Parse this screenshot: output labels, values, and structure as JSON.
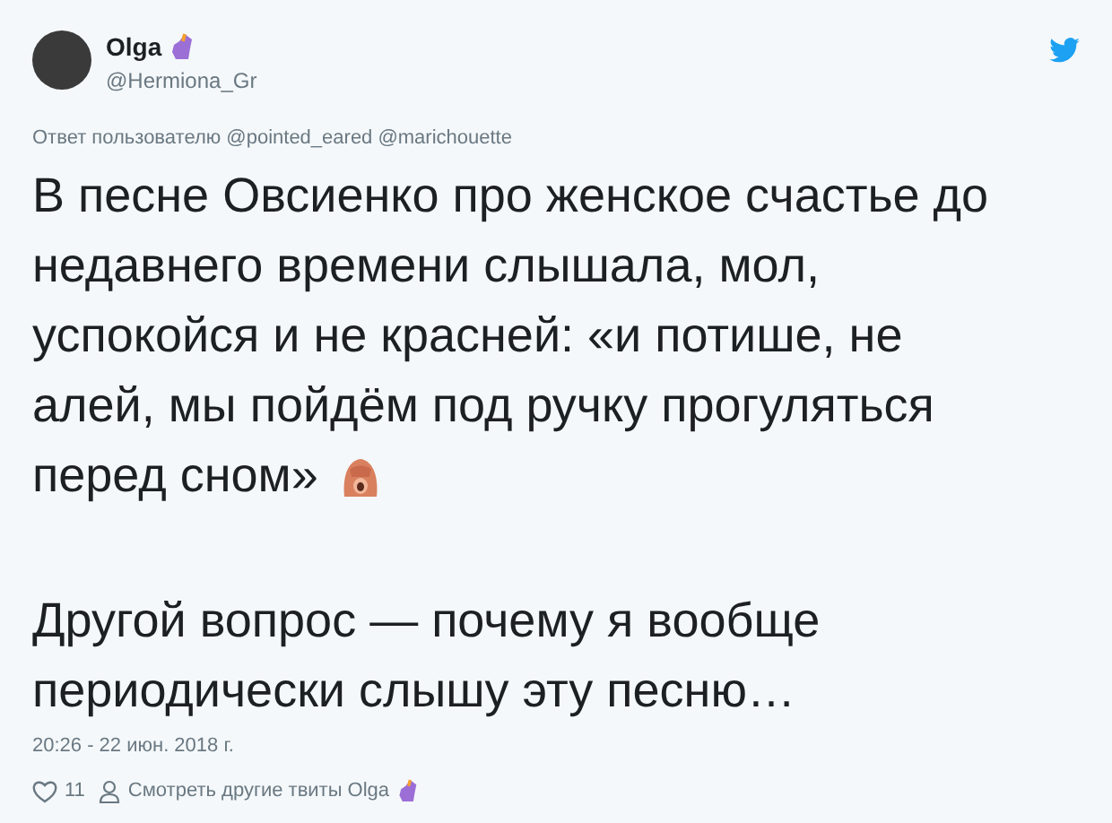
{
  "author": {
    "name": "Olga",
    "handle": "@Hermiona_Gr"
  },
  "reply_to": {
    "prefix": "Ответ пользователю",
    "mentions": [
      "@pointed_eared",
      "@marichouette"
    ]
  },
  "paragraphs": [
    {
      "lines": [
        "В песне Овсиенко про женское счастье до",
        "недавнего времени слышала, мол,",
        "успокойся и не красней: «и потише, не",
        "алей, мы пойдём под ручку прогуляться",
        "перед сном»"
      ],
      "emoji_after": true
    },
    {
      "lines": [
        "Другой вопрос — почему я вообще",
        "периодически слышу эту песню…"
      ]
    }
  ],
  "timestamp": "20:26 - 22 июн. 2018 г.",
  "likes": "11",
  "more_tweets_link": "Смотреть другие твиты Olga"
}
